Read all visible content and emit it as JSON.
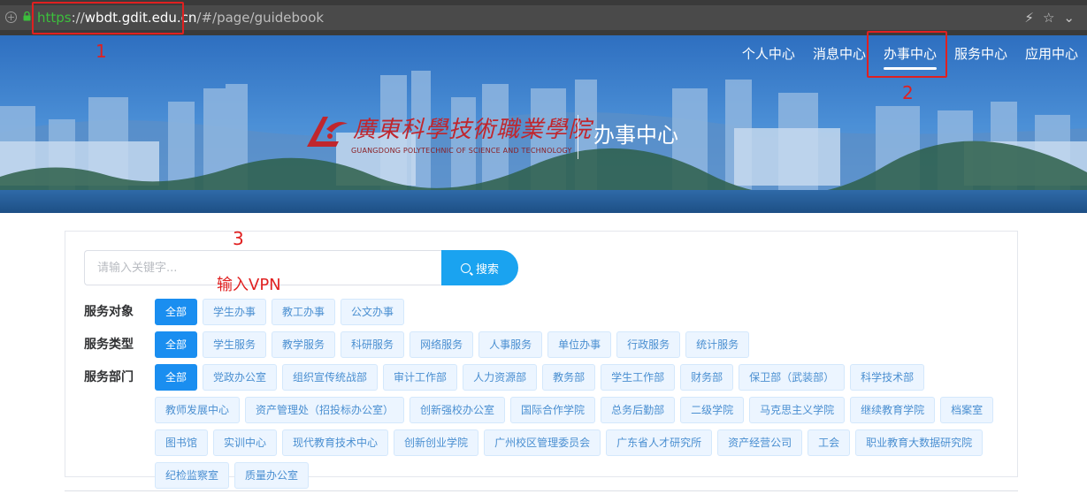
{
  "browser": {
    "url_scheme": "https",
    "url_sep": "://",
    "url_host": "wbdt.gdit.edu.cn",
    "url_path": "/#/page/guidebook",
    "icons": [
      "lightning-icon",
      "star-icon",
      "chevron-down-icon"
    ]
  },
  "annotations": {
    "n1": "1",
    "n2": "2",
    "n3": "3",
    "hint": "输入VPN",
    "color": "#e02020"
  },
  "nav": {
    "items": [
      {
        "label": "个人中心"
      },
      {
        "label": "消息中心"
      },
      {
        "label": "办事中心",
        "active": true
      },
      {
        "label": "服务中心"
      },
      {
        "label": "应用中心"
      }
    ]
  },
  "logo": {
    "cn": "廣東科學技術職業學院",
    "en": "GUANGDONG POLYTECHNIC OF SCIENCE AND TECHNOLOGY",
    "title": "办事中心"
  },
  "search": {
    "placeholder": "请输入关键字...",
    "value": "",
    "button": "搜索"
  },
  "filters": {
    "target": {
      "label": "服务对象",
      "tags": [
        "全部",
        "学生办事",
        "教工办事",
        "公文办事"
      ]
    },
    "type": {
      "label": "服务类型",
      "tags": [
        "全部",
        "学生服务",
        "教学服务",
        "科研服务",
        "网络服务",
        "人事服务",
        "单位办事",
        "行政服务",
        "统计服务"
      ]
    },
    "dept": {
      "label": "服务部门",
      "tags": [
        "全部",
        "党政办公室",
        "组织宣传统战部",
        "审计工作部",
        "人力资源部",
        "教务部",
        "学生工作部",
        "财务部",
        "保卫部（武装部）",
        "科学技术部",
        "教师发展中心",
        "资产管理处（招投标办公室）",
        "创新强校办公室",
        "国际合作学院",
        "总务后勤部",
        "二级学院",
        "马克思主义学院",
        "继续教育学院",
        "档案室",
        "图书馆",
        "实训中心",
        "现代教育技术中心",
        "创新创业学院",
        "广州校区管理委员会",
        "广东省人才研究所",
        "资产经营公司",
        "工会",
        "职业教育大数据研究院",
        "纪检监察室",
        "质量办公室"
      ]
    }
  },
  "colors": {
    "accent": "#1a8ef0",
    "search_button": "#1aa3f0",
    "tag_text": "#4a8fd1",
    "tag_bg": "#ecf5ff",
    "logo_red": "#c0262d"
  }
}
